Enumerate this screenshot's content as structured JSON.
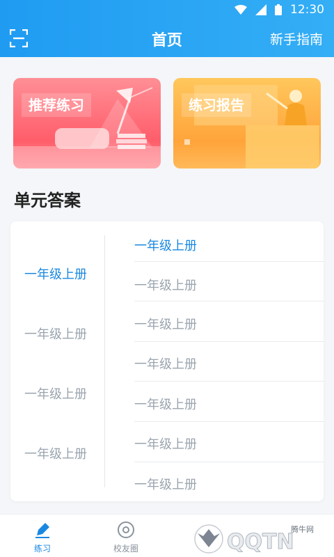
{
  "status": {
    "time": "12:30"
  },
  "header": {
    "title": "首页",
    "guide_label": "新手指南"
  },
  "cards": [
    {
      "label": "推荐练习"
    },
    {
      "label": "练习报告"
    }
  ],
  "section": {
    "title": "单元答案"
  },
  "grades_left": [
    {
      "label": "一年级上册",
      "active": true
    },
    {
      "label": "一年级上册",
      "active": false
    },
    {
      "label": "一年级上册",
      "active": false
    },
    {
      "label": "一年级上册",
      "active": false
    }
  ],
  "grades_right": [
    {
      "label": "一年级上册",
      "active": true
    },
    {
      "label": "一年级上册",
      "active": false
    },
    {
      "label": "一年级上册",
      "active": false
    },
    {
      "label": "一年级上册",
      "active": false
    },
    {
      "label": "一年级上册",
      "active": false
    },
    {
      "label": "一年级上册",
      "active": false
    },
    {
      "label": "一年级上册",
      "active": false
    }
  ],
  "tabs": [
    {
      "label": "练习",
      "icon": "pencil-icon"
    },
    {
      "label": "校友圈",
      "icon": "circle-icon"
    }
  ],
  "watermark": {
    "text": "QQTN",
    "sub": "腾牛网"
  },
  "colors": {
    "accent": "#1a88e0",
    "header": "#2aa5f4",
    "muted": "#9aa4ae"
  }
}
